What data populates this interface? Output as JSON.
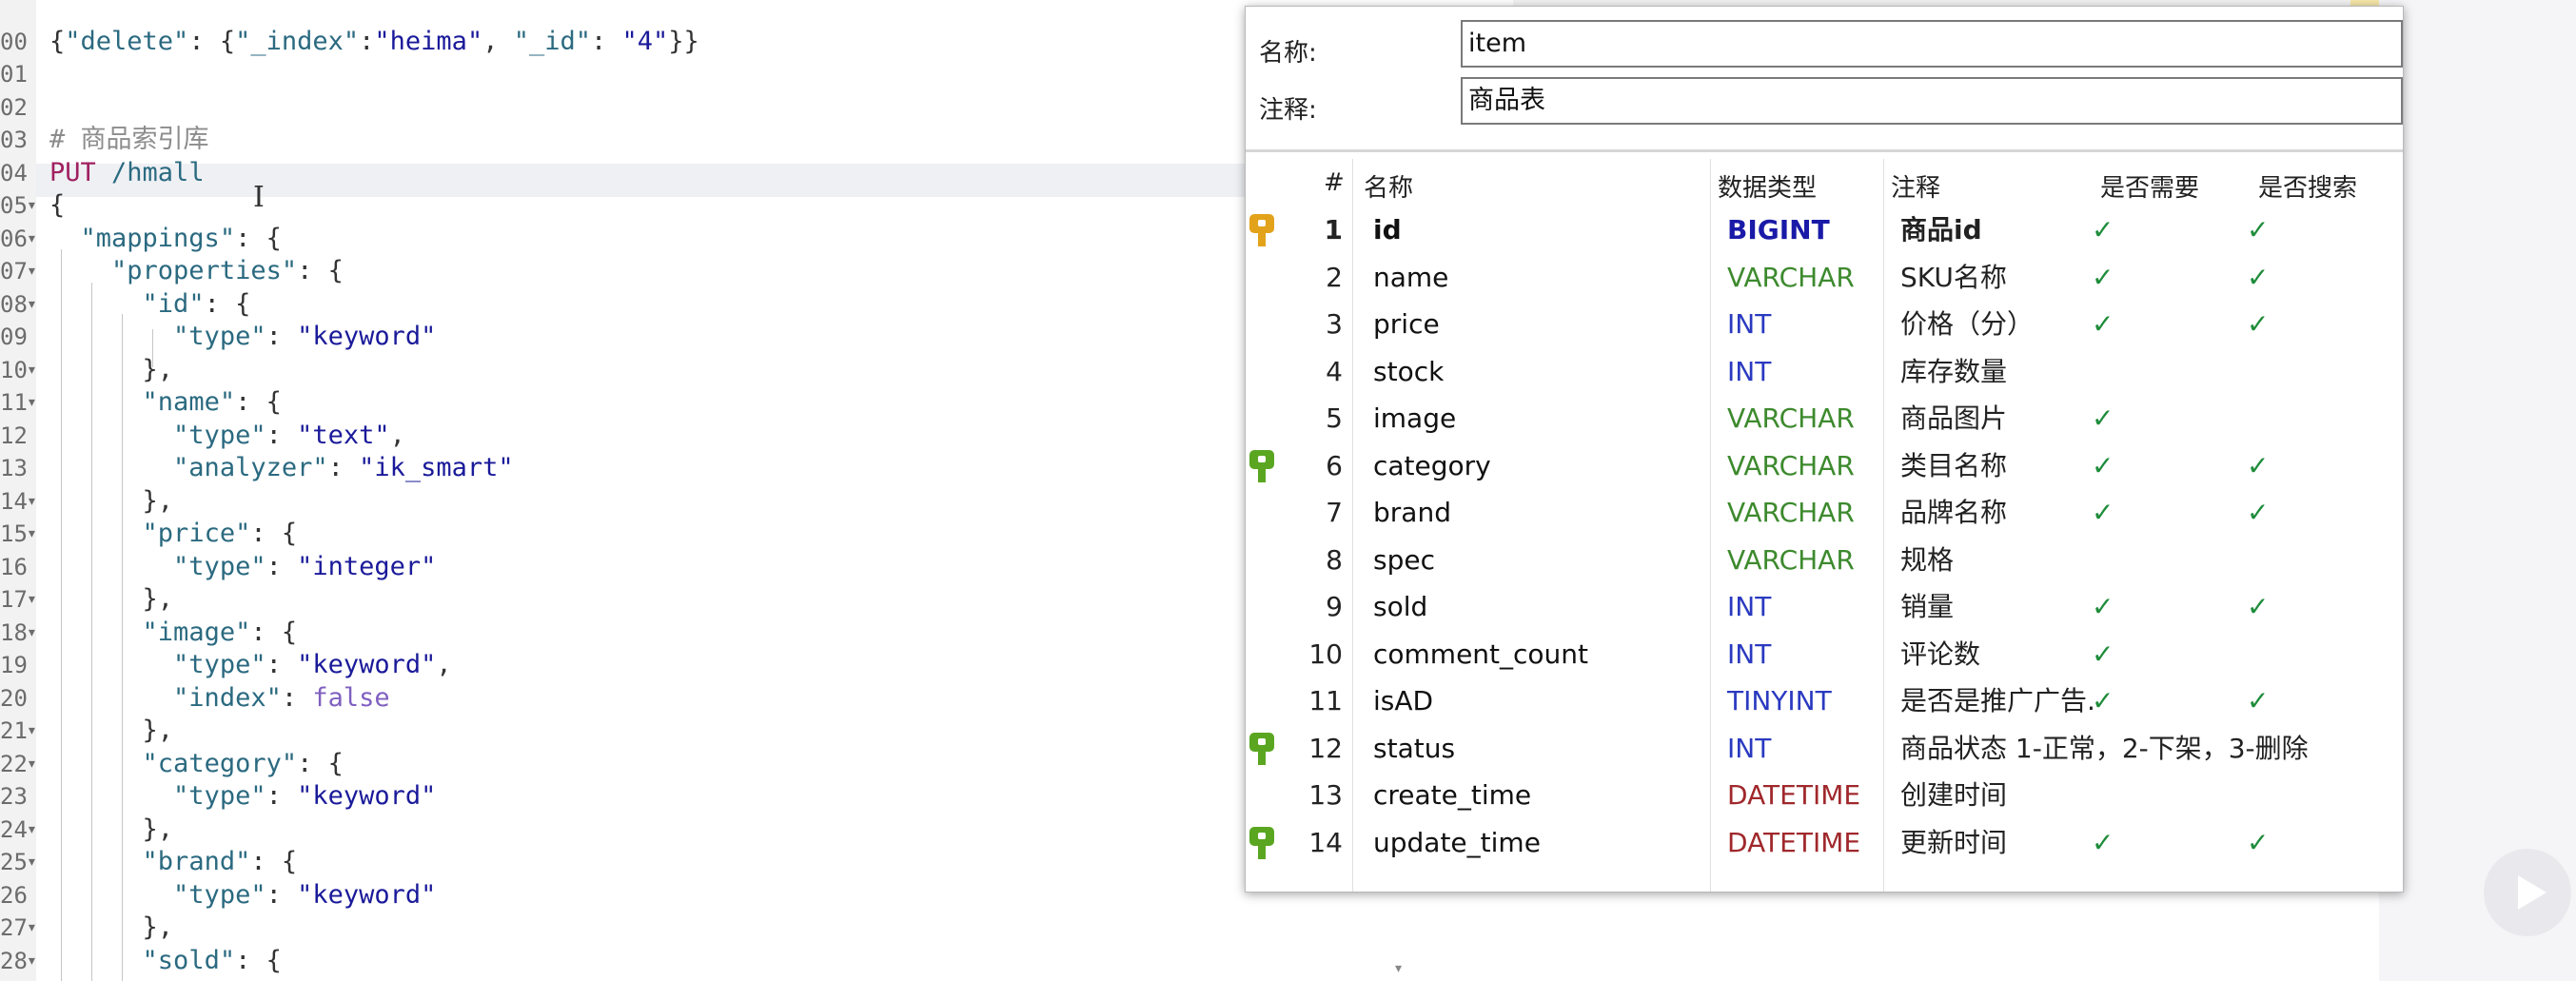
{
  "editor": {
    "lines": [
      {
        "n": "",
        "fold": false,
        "tokens": []
      },
      {
        "n": "00",
        "fold": false,
        "tokens": [
          [
            "p",
            "{"
          ],
          [
            "k",
            "\"delete\""
          ],
          [
            "p",
            ": {"
          ],
          [
            "k",
            "\"_index\""
          ],
          [
            "p",
            ":"
          ],
          [
            "s",
            "\"heima\""
          ],
          [
            "p",
            ", "
          ],
          [
            "k",
            "\"_id\""
          ],
          [
            "p",
            ": "
          ],
          [
            "s",
            "\"4\""
          ],
          [
            "p",
            "}}"
          ]
        ]
      },
      {
        "n": "01",
        "fold": false,
        "tokens": []
      },
      {
        "n": "02",
        "fold": false,
        "tokens": []
      },
      {
        "n": "03",
        "fold": false,
        "tokens": [
          [
            "cm",
            "# 商品索引库"
          ]
        ]
      },
      {
        "n": "04",
        "fold": false,
        "tokens": [
          [
            "m",
            "PUT"
          ],
          [
            "k",
            " /hmall"
          ]
        ]
      },
      {
        "n": "05",
        "fold": true,
        "tokens": [
          [
            "p",
            "{"
          ]
        ]
      },
      {
        "n": "06",
        "fold": true,
        "tokens": [
          [
            "p",
            "  "
          ],
          [
            "k",
            "\"mappings\""
          ],
          [
            "p",
            ": {"
          ]
        ]
      },
      {
        "n": "07",
        "fold": true,
        "tokens": [
          [
            "p",
            "    "
          ],
          [
            "k",
            "\"properties\""
          ],
          [
            "p",
            ": {"
          ]
        ]
      },
      {
        "n": "08",
        "fold": true,
        "tokens": [
          [
            "p",
            "      "
          ],
          [
            "k",
            "\"id\""
          ],
          [
            "p",
            ": {"
          ]
        ]
      },
      {
        "n": "09",
        "fold": false,
        "tokens": [
          [
            "p",
            "        "
          ],
          [
            "k",
            "\"type\""
          ],
          [
            "p",
            ": "
          ],
          [
            "s",
            "\"keyword\""
          ]
        ]
      },
      {
        "n": "10",
        "fold": true,
        "tokens": [
          [
            "p",
            "      },"
          ]
        ]
      },
      {
        "n": "11",
        "fold": true,
        "tokens": [
          [
            "p",
            "      "
          ],
          [
            "k",
            "\"name\""
          ],
          [
            "p",
            ": {"
          ]
        ]
      },
      {
        "n": "12",
        "fold": false,
        "tokens": [
          [
            "p",
            "        "
          ],
          [
            "k",
            "\"type\""
          ],
          [
            "p",
            ": "
          ],
          [
            "s",
            "\"text\""
          ],
          [
            "p",
            ","
          ]
        ]
      },
      {
        "n": "13",
        "fold": false,
        "tokens": [
          [
            "p",
            "        "
          ],
          [
            "k",
            "\"analyzer\""
          ],
          [
            "p",
            ": "
          ],
          [
            "s",
            "\"ik_smart\""
          ]
        ]
      },
      {
        "n": "14",
        "fold": true,
        "tokens": [
          [
            "p",
            "      },"
          ]
        ]
      },
      {
        "n": "15",
        "fold": true,
        "tokens": [
          [
            "p",
            "      "
          ],
          [
            "k",
            "\"price\""
          ],
          [
            "p",
            ": {"
          ]
        ]
      },
      {
        "n": "16",
        "fold": false,
        "tokens": [
          [
            "p",
            "        "
          ],
          [
            "k",
            "\"type\""
          ],
          [
            "p",
            ": "
          ],
          [
            "s",
            "\"integer\""
          ]
        ]
      },
      {
        "n": "17",
        "fold": true,
        "tokens": [
          [
            "p",
            "      },"
          ]
        ]
      },
      {
        "n": "18",
        "fold": true,
        "tokens": [
          [
            "p",
            "      "
          ],
          [
            "k",
            "\"image\""
          ],
          [
            "p",
            ": {"
          ]
        ]
      },
      {
        "n": "19",
        "fold": false,
        "tokens": [
          [
            "p",
            "        "
          ],
          [
            "k",
            "\"type\""
          ],
          [
            "p",
            ": "
          ],
          [
            "s",
            "\"keyword\""
          ],
          [
            "p",
            ","
          ]
        ]
      },
      {
        "n": "20",
        "fold": false,
        "tokens": [
          [
            "p",
            "        "
          ],
          [
            "k",
            "\"index\""
          ],
          [
            "p",
            ": "
          ],
          [
            "bool",
            "false"
          ]
        ]
      },
      {
        "n": "21",
        "fold": true,
        "tokens": [
          [
            "p",
            "      },"
          ]
        ]
      },
      {
        "n": "22",
        "fold": true,
        "tokens": [
          [
            "p",
            "      "
          ],
          [
            "k",
            "\"category\""
          ],
          [
            "p",
            ": {"
          ]
        ]
      },
      {
        "n": "23",
        "fold": false,
        "tokens": [
          [
            "p",
            "        "
          ],
          [
            "k",
            "\"type\""
          ],
          [
            "p",
            ": "
          ],
          [
            "s",
            "\"keyword\""
          ]
        ]
      },
      {
        "n": "24",
        "fold": true,
        "tokens": [
          [
            "p",
            "      },"
          ]
        ]
      },
      {
        "n": "25",
        "fold": true,
        "tokens": [
          [
            "p",
            "      "
          ],
          [
            "k",
            "\"brand\""
          ],
          [
            "p",
            ": {"
          ]
        ]
      },
      {
        "n": "26",
        "fold": false,
        "tokens": [
          [
            "p",
            "        "
          ],
          [
            "k",
            "\"type\""
          ],
          [
            "p",
            ": "
          ],
          [
            "s",
            "\"keyword\""
          ]
        ]
      },
      {
        "n": "27",
        "fold": true,
        "tokens": [
          [
            "p",
            "      },"
          ]
        ]
      },
      {
        "n": "28",
        "fold": true,
        "tokens": [
          [
            "p",
            "      "
          ],
          [
            "k",
            "\"sold\""
          ],
          [
            "p",
            ": {"
          ]
        ]
      }
    ]
  },
  "dialog": {
    "name_label": "名称:",
    "name_value": "item",
    "comment_label": "注释:",
    "comment_value": "商品表",
    "headers": {
      "num": "#",
      "name": "名称",
      "type": "数据类型",
      "comment": "注释",
      "required": "是否需要",
      "search": "是否搜索"
    },
    "check_glyph": "✓",
    "colors": {
      "gold_key": "#e2a21a",
      "green_key": "#5aa621",
      "bigint": "#1a1aa8",
      "varchar": "#3d8a2e",
      "int": "#2a3ac0",
      "tinyint": "#2a3ac0",
      "datetime": "#a0282c",
      "check": "#1e8c3a"
    },
    "rows": [
      {
        "num": "1",
        "name": "id",
        "type": "BIGINT",
        "comment": "商品id",
        "required": true,
        "search": true,
        "key": "gold",
        "bold": true
      },
      {
        "num": "2",
        "name": "name",
        "type": "VARCHAR",
        "comment": "SKU名称",
        "required": true,
        "search": true,
        "key": "none",
        "bold": false
      },
      {
        "num": "3",
        "name": "price",
        "type": "INT",
        "comment": "价格（分）",
        "required": true,
        "search": true,
        "key": "none",
        "bold": false
      },
      {
        "num": "4",
        "name": "stock",
        "type": "INT",
        "comment": "库存数量",
        "required": false,
        "search": false,
        "key": "none",
        "bold": false
      },
      {
        "num": "5",
        "name": "image",
        "type": "VARCHAR",
        "comment": "商品图片",
        "required": true,
        "search": false,
        "key": "none",
        "bold": false
      },
      {
        "num": "6",
        "name": "category",
        "type": "VARCHAR",
        "comment": "类目名称",
        "required": true,
        "search": true,
        "key": "green",
        "bold": false
      },
      {
        "num": "7",
        "name": "brand",
        "type": "VARCHAR",
        "comment": "品牌名称",
        "required": true,
        "search": true,
        "key": "none",
        "bold": false
      },
      {
        "num": "8",
        "name": "spec",
        "type": "VARCHAR",
        "comment": "规格",
        "required": false,
        "search": false,
        "key": "none",
        "bold": false
      },
      {
        "num": "9",
        "name": "sold",
        "type": "INT",
        "comment": "销量",
        "required": true,
        "search": true,
        "key": "none",
        "bold": false
      },
      {
        "num": "10",
        "name": "comment_count",
        "type": "INT",
        "comment": "评论数",
        "required": true,
        "search": false,
        "key": "none",
        "bold": false
      },
      {
        "num": "11",
        "name": "isAD",
        "type": "TINYINT",
        "comment": "是否是推广广告.",
        "required": true,
        "search": true,
        "key": "none",
        "bold": false
      },
      {
        "num": "12",
        "name": "status",
        "type": "INT",
        "comment": "商品状态 1-正常，2-下架，3-删除",
        "required": false,
        "search": false,
        "key": "green",
        "bold": false
      },
      {
        "num": "13",
        "name": "create_time",
        "type": "DATETIME",
        "comment": "创建时间",
        "required": false,
        "search": false,
        "key": "none",
        "bold": false
      },
      {
        "num": "14",
        "name": "update_time",
        "type": "DATETIME",
        "comment": "更新时间",
        "required": true,
        "search": true,
        "key": "green",
        "bold": false
      }
    ]
  }
}
